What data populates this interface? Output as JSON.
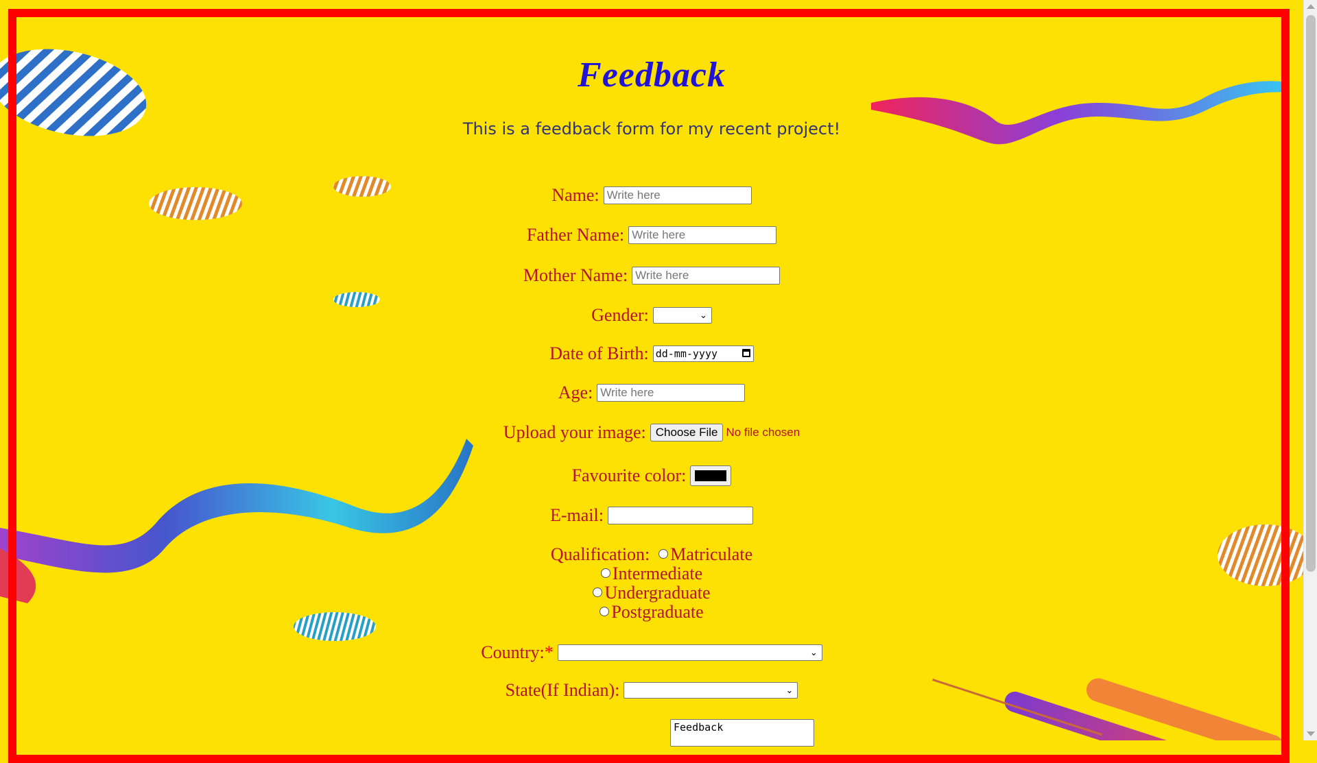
{
  "page": {
    "title": "Feedback",
    "subtitle": "This is a feedback form for my recent project!"
  },
  "form": {
    "name": {
      "label": "Name:",
      "placeholder": "Write here"
    },
    "father_name": {
      "label": "Father Name:",
      "placeholder": "Write here"
    },
    "mother_name": {
      "label": "Mother Name:",
      "placeholder": "Write here"
    },
    "gender": {
      "label": "Gender:",
      "value": ""
    },
    "dob": {
      "label": "Date of Birth:",
      "placeholder": "dd-mm-yyyy"
    },
    "age": {
      "label": "Age:",
      "placeholder": "Write here"
    },
    "upload": {
      "label": "Upload your image:",
      "button": "Choose File",
      "status": "No file chosen"
    },
    "favourite_color": {
      "label": "Favourite color:",
      "value": "#000000"
    },
    "email": {
      "label": "E-mail:",
      "value": ""
    },
    "qualification": {
      "label": "Qualification:",
      "options": [
        "Matriculate",
        "Intermediate",
        "Undergraduate",
        "Postgraduate"
      ]
    },
    "country": {
      "label": "Country:",
      "required_mark": "*",
      "value": ""
    },
    "state": {
      "label": "State(If Indian):",
      "value": ""
    },
    "feedback": {
      "value": "Feedback"
    }
  },
  "colors": {
    "background": "#fde102",
    "frame": "#ff0000",
    "title": "#2114d6",
    "label": "#b5122e"
  }
}
